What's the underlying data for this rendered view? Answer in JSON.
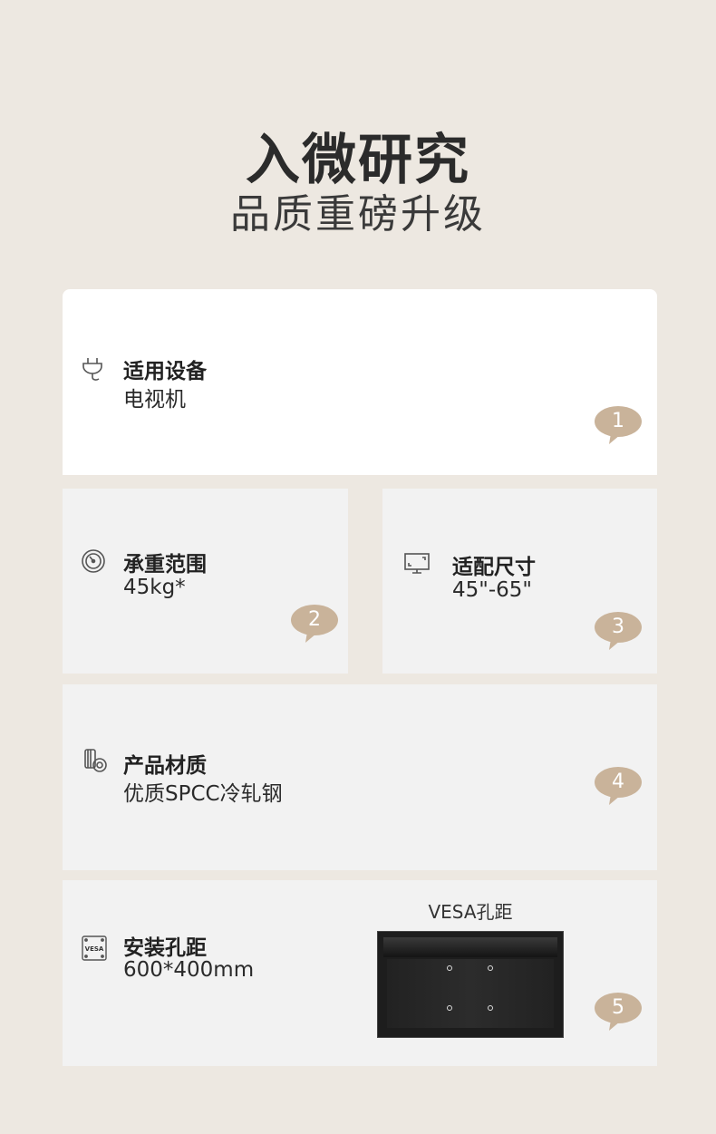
{
  "header": {
    "title": "入微研究",
    "subtitle": "品质重磅升级"
  },
  "colors": {
    "background": "#ede8e1",
    "card": "#f2f2f2",
    "bubble": "#c9b39a"
  },
  "features": [
    {
      "icon": "plug-icon",
      "title": "适用设备",
      "value": "电视机",
      "number": "1"
    },
    {
      "icon": "gauge-icon",
      "title": "承重范围",
      "value": "45kg*",
      "number": "2"
    },
    {
      "icon": "monitor-icon",
      "title": "适配尺寸",
      "value": "45\"-65\"",
      "number": "3"
    },
    {
      "icon": "steel-coil-icon",
      "title": "产品材质",
      "value": "优质SPCC冷轧钢",
      "number": "4"
    },
    {
      "icon": "vesa-icon",
      "title": "安装孔距",
      "value": "600*400mm",
      "number": "5"
    }
  ],
  "vesa_figure": {
    "caption": "VESA孔距",
    "badge_text": "VESA"
  }
}
